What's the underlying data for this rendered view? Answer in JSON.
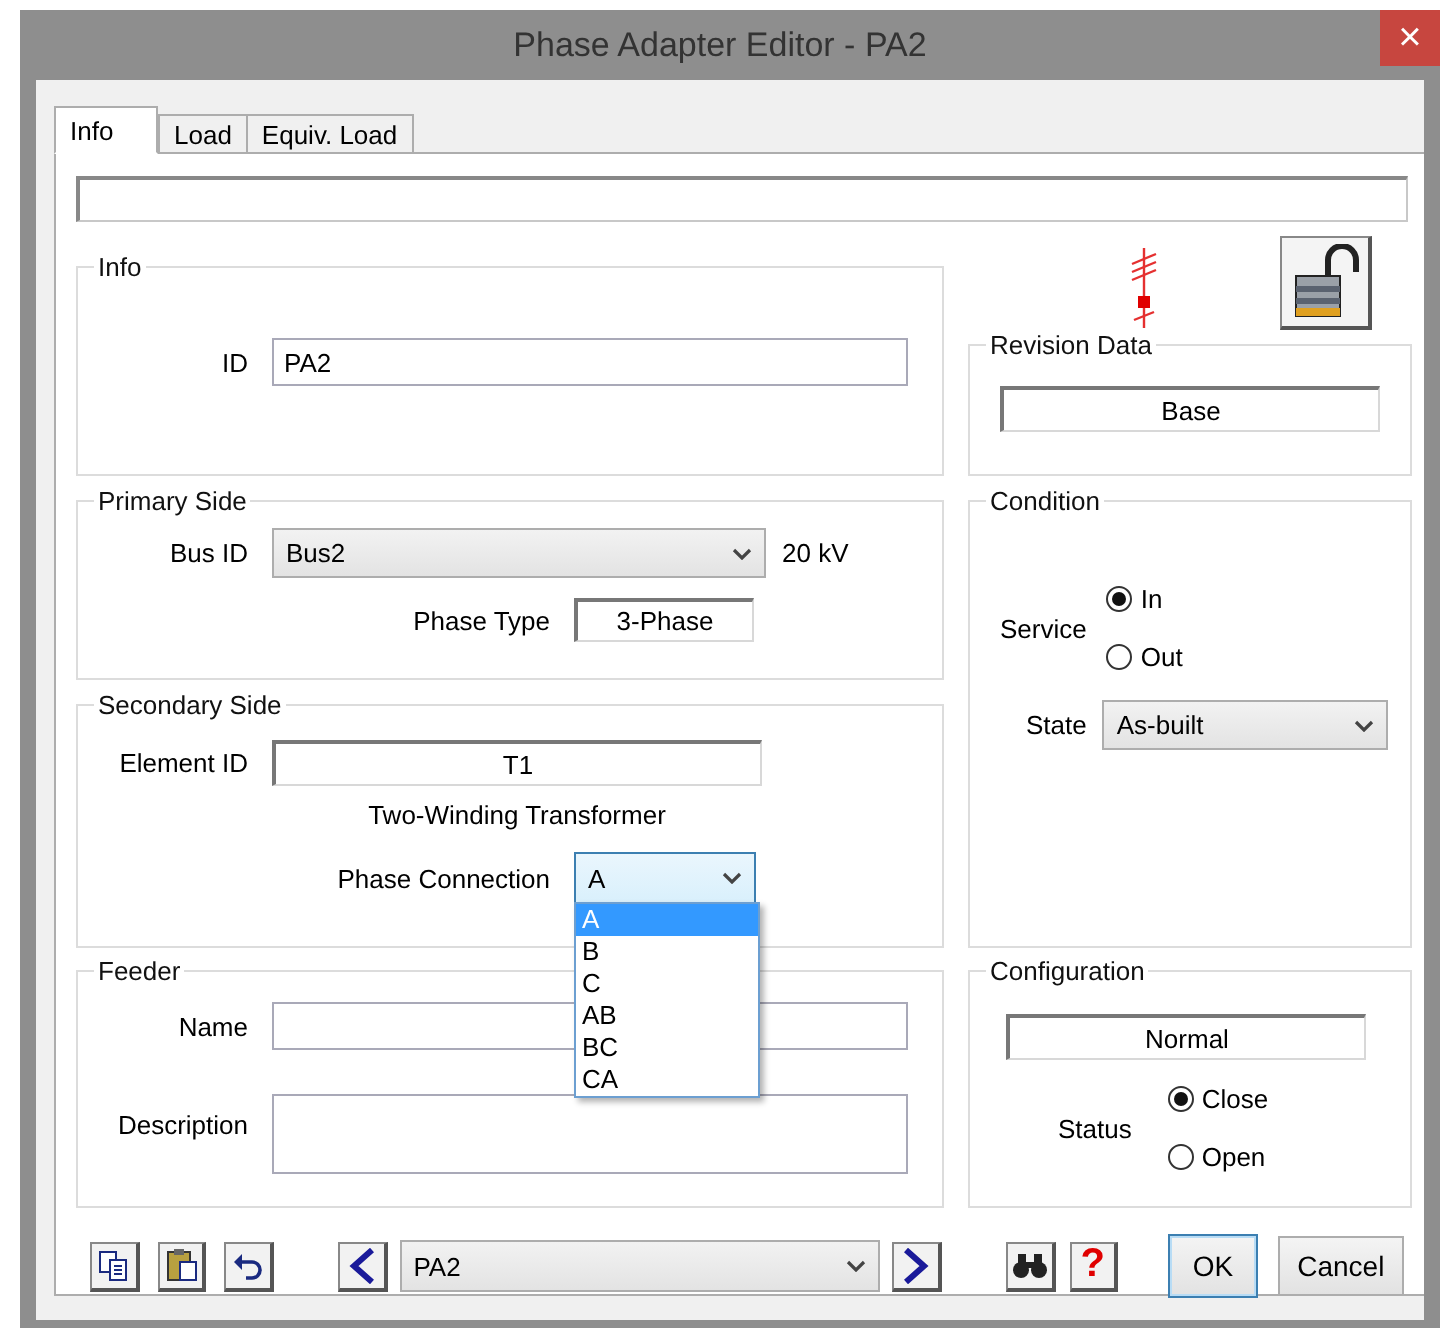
{
  "window": {
    "title": "Phase Adapter Editor - PA2",
    "close": "×"
  },
  "tabs": [
    {
      "label": "Info",
      "selected": true
    },
    {
      "label": "Load",
      "selected": false
    },
    {
      "label": "Equiv. Load",
      "selected": false
    }
  ],
  "info": {
    "title": "Info",
    "id_label": "ID",
    "id_value": "PA2"
  },
  "revision_data": {
    "title": "Revision Data",
    "value": "Base"
  },
  "primary_side": {
    "title": "Primary Side",
    "bus_id_label": "Bus ID",
    "bus_id_value": "Bus2",
    "voltage": "20 kV",
    "phase_type_label": "Phase Type",
    "phase_type_value": "3-Phase"
  },
  "secondary_side": {
    "title": "Secondary Side",
    "element_id_label": "Element ID",
    "element_id_value": "T1",
    "element_type": "Two-Winding Transformer",
    "phase_connection_label": "Phase Connection",
    "phase_connection_value": "A",
    "phase_connection_expanded": true,
    "phase_connection_options": [
      {
        "label": "A",
        "selected": true
      },
      {
        "label": "B",
        "selected": false
      },
      {
        "label": "C",
        "selected": false
      },
      {
        "label": "AB",
        "selected": false
      },
      {
        "label": "BC",
        "selected": false
      },
      {
        "label": "CA",
        "selected": false
      }
    ]
  },
  "condition": {
    "title": "Condition",
    "service_label": "Service",
    "service_options": [
      {
        "label": "In",
        "selected": true
      },
      {
        "label": "Out",
        "selected": false
      }
    ],
    "state_label": "State",
    "state_value": "As-built"
  },
  "feeder": {
    "title": "Feeder",
    "name_label": "Name",
    "description_label": "Description"
  },
  "configuration": {
    "title": "Configuration",
    "value": "Normal",
    "status_label": "Status",
    "status_options": [
      {
        "label": "Close",
        "selected": true
      },
      {
        "label": "Open",
        "selected": false
      }
    ]
  },
  "navigator": {
    "value": "PA2"
  },
  "help_button": "?",
  "buttons": {
    "ok": "OK",
    "cancel": "Cancel"
  }
}
